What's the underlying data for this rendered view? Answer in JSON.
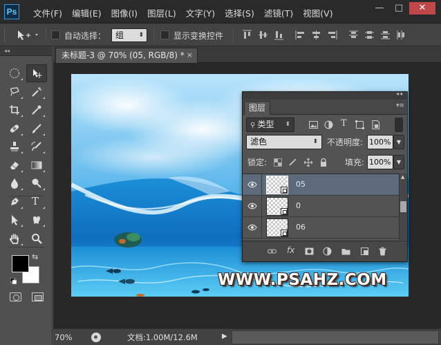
{
  "app": {
    "logo": "Ps",
    "menu": [
      "文件(F)",
      "编辑(E)",
      "图像(I)",
      "图层(L)",
      "文字(Y)",
      "选择(S)",
      "滤镜(T)",
      "视图(V)"
    ],
    "window_buttons": {
      "minimize": "—",
      "restore": "□",
      "close": "✕"
    }
  },
  "options_bar": {
    "auto_select_label": "自动选择：",
    "auto_select_value": "组",
    "show_transform_label": "显示变换控件"
  },
  "toolbox": {
    "collapse_glyph": "◂◂",
    "tools": [
      "move-tool",
      "marquee-tool",
      "lasso-tool",
      "magic-wand-tool",
      "crop-tool",
      "eyedropper-tool",
      "healing-brush-tool",
      "brush-tool",
      "clone-stamp-tool",
      "history-brush-tool",
      "eraser-tool",
      "gradient-tool",
      "blur-tool",
      "dodge-tool",
      "pen-tool",
      "type-tool",
      "path-selection-tool",
      "shape-tool",
      "hand-tool",
      "zoom-tool"
    ],
    "type_tool_glyph": "T",
    "foreground_color": "#000000",
    "background_color": "#ffffff"
  },
  "document": {
    "tab_title": "未标题-3 @ 70% (05, RGB/8) *",
    "tab_close": "×",
    "watermark": "WWW.PSAHZ.COM"
  },
  "layers_panel": {
    "collapse_glyph": "◂◂",
    "tab_label": "图层",
    "filter_kind": "类型",
    "blend_mode": "滤色",
    "opacity_label": "不透明度:",
    "opacity_value": "100%",
    "lock_label": "锁定:",
    "fill_label": "填充:",
    "fill_value": "100%",
    "layers": [
      {
        "name": "05",
        "visible": true,
        "selected": true
      },
      {
        "name": "0",
        "visible": true,
        "selected": false
      },
      {
        "name": "06",
        "visible": true,
        "selected": false
      }
    ],
    "fx_glyph": "fx"
  },
  "status_bar": {
    "zoom": "70%",
    "doc_info": "文档:1.00M/12.6M",
    "arrow": "▶"
  },
  "colors": {
    "selected_layer": "#5d6a7c",
    "close_button": "#c04848"
  }
}
